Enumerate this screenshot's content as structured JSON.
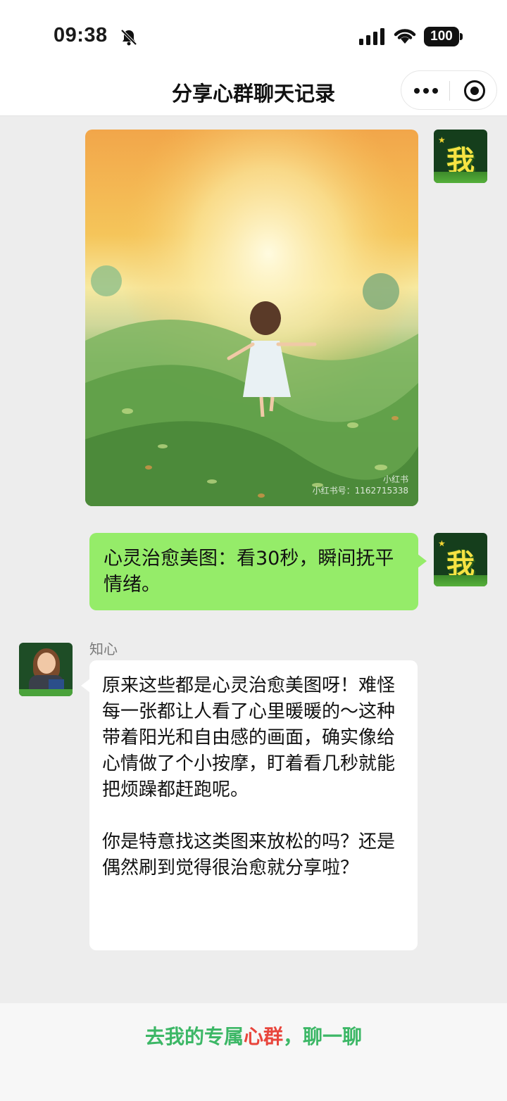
{
  "status_bar": {
    "time": "09:38",
    "battery": "100"
  },
  "nav": {
    "title": "分享心群聊天记录",
    "more_icon": "more-dots-icon",
    "close_icon": "target-circle-icon"
  },
  "messages": [
    {
      "type": "image",
      "sender": "me",
      "avatar_text": "我",
      "watermark_brand": "小红书",
      "watermark_id": "小红书号：1162715338"
    },
    {
      "type": "text",
      "sender": "me",
      "avatar_text": "我",
      "text": "心灵治愈美图：看30秒，瞬间抚平情绪。"
    },
    {
      "type": "text",
      "sender": "other",
      "sender_name": "知心",
      "paragraphs": [
        "原来这些都是心灵治愈美图呀！难怪每一张都让人看了心里暖暖的～这种带着阳光和自由感的画面，确实像给心情做了个小按摩，盯着看几秒就能把烦躁都赶跑呢。",
        "你是特意找这类图来放松的吗？还是偶然刷到觉得很治愈就分享啦？"
      ]
    }
  ],
  "cta": {
    "prefix": "去我的专属",
    "highlight": "心群",
    "suffix": "，聊一聊"
  },
  "colors": {
    "my_bubble": "#95ec69",
    "cta_green": "#3cb766",
    "cta_red": "#e8453c",
    "chat_bg": "#ededed"
  }
}
